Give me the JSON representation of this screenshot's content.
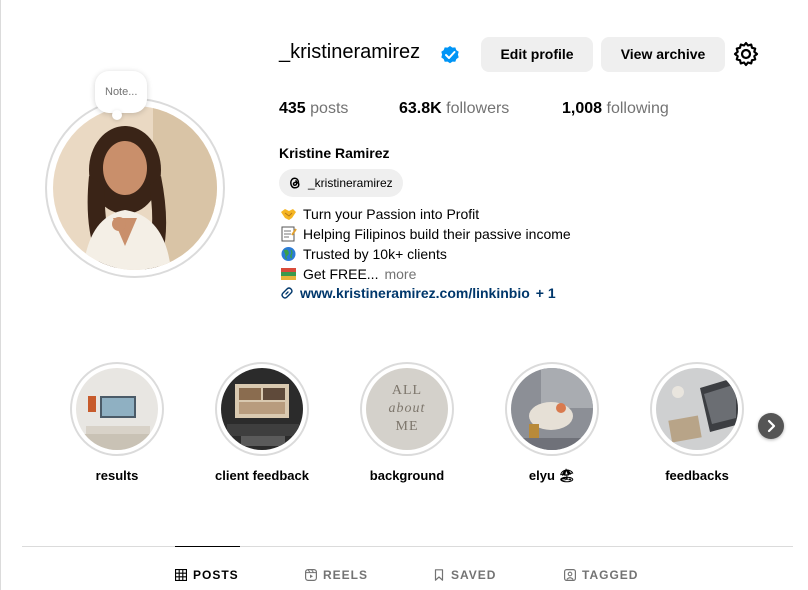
{
  "profile": {
    "username": "_kristineramirez",
    "full_name": "Kristine Ramirez",
    "note_placeholder": "Note...",
    "threads_handle": "_kristineramirez",
    "verified": true
  },
  "actions": {
    "edit_profile": "Edit profile",
    "view_archive": "View archive"
  },
  "stats": {
    "posts_count": "435",
    "posts_label": "posts",
    "followers_count": "63.8K",
    "followers_label": "followers",
    "following_count": "1,008",
    "following_label": "following"
  },
  "bio": {
    "lines": [
      {
        "icon": "handshake-emoji-icon",
        "text": "Turn your Passion into Profit"
      },
      {
        "icon": "memo-emoji-icon",
        "text": "Helping Filipinos build their passive income"
      },
      {
        "icon": "globe-emoji-icon",
        "text": "Trusted by 10k+ clients"
      },
      {
        "icon": "books-emoji-icon",
        "text": "Get FREE..."
      }
    ],
    "more_label": "more",
    "link_text": "www.kristineramirez.com/linkinbio",
    "link_extra": "+ 1"
  },
  "highlights": [
    {
      "label": "results"
    },
    {
      "label": "client feedback"
    },
    {
      "label": "background"
    },
    {
      "label": "elyu 🏖"
    },
    {
      "label": "feedbacks"
    }
  ],
  "highlight_background_text": [
    "ALL",
    "about",
    "ME"
  ],
  "tabs": [
    {
      "label": "POSTS",
      "active": true
    },
    {
      "label": "REELS",
      "active": false
    },
    {
      "label": "SAVED",
      "active": false
    },
    {
      "label": "TAGGED",
      "active": false
    }
  ],
  "colors": {
    "link": "#00376b",
    "verified": "#0095f6",
    "secondary_text": "#737373",
    "button_bg": "#efefef"
  }
}
